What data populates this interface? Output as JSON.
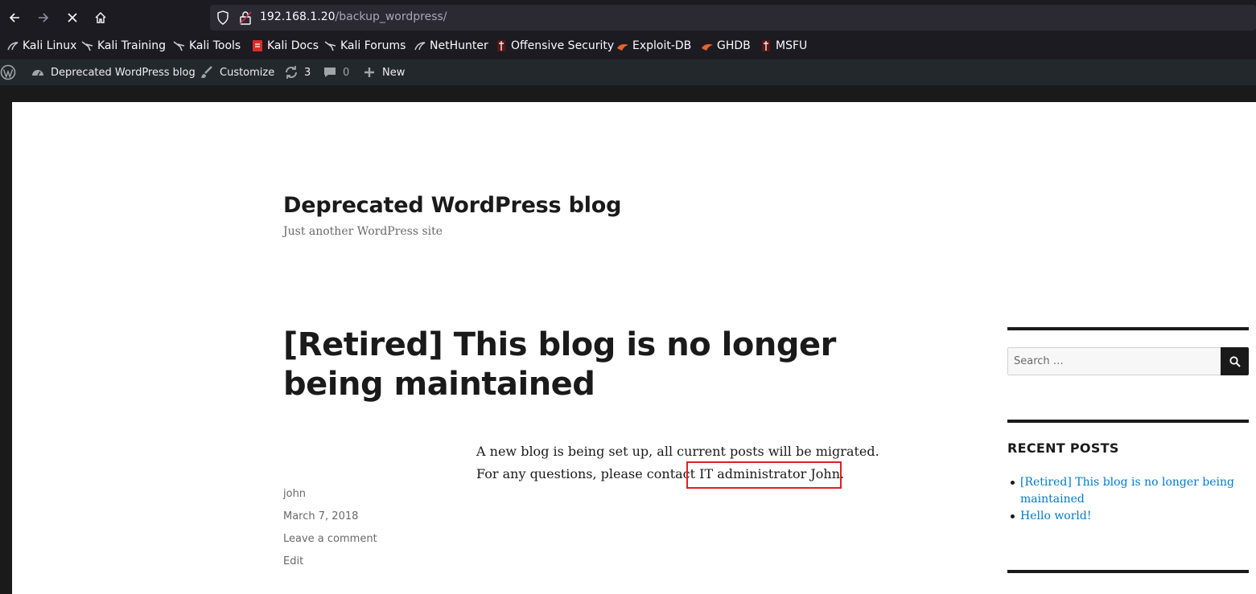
{
  "browser": {
    "url_host": "192.168.1.20",
    "url_path": "/backup_wordpress/",
    "bookmarks": [
      {
        "label": "Kali Linux",
        "icon": "kali-dragon-icon"
      },
      {
        "label": "Kali Training",
        "icon": "kali-dragon-icon"
      },
      {
        "label": "Kali Tools",
        "icon": "kali-dragon-icon"
      },
      {
        "label": "Kali Docs",
        "icon": "kali-docs-icon"
      },
      {
        "label": "Kali Forums",
        "icon": "kali-dragon-icon"
      },
      {
        "label": "NetHunter",
        "icon": "nethunter-icon"
      },
      {
        "label": "Offensive Security",
        "icon": "offsec-icon"
      },
      {
        "label": "Exploit-DB",
        "icon": "exploitdb-icon"
      },
      {
        "label": "GHDB",
        "icon": "ghdb-icon"
      },
      {
        "label": "MSFU",
        "icon": "msfu-icon"
      }
    ]
  },
  "adminbar": {
    "site_name": "Deprecated WordPress blog",
    "customize": "Customize",
    "updates_count": "3",
    "comments_count": "0",
    "new": "New"
  },
  "site": {
    "title": "Deprecated WordPress blog",
    "description": "Just another WordPress site"
  },
  "post": {
    "title": "[Retired] This blog is no longer being maintained",
    "line1": "A new blog is being set up, all current posts will be migrated.",
    "line2_prefix": "For any questions, please contact ",
    "line2_highlight": "IT administrator John.",
    "author": "john",
    "date": "March 7, 2018",
    "comment_link": "Leave a comment",
    "edit_link": "Edit"
  },
  "sidebar": {
    "search_placeholder": "Search …",
    "recent_title": "RECENT POSTS",
    "recent_posts": [
      "[Retired] This blog is no longer being maintained",
      "Hello world!"
    ]
  },
  "colors": {
    "link": "#007acc",
    "highlight_box": "#e02020",
    "adminbar": "#23282d"
  }
}
